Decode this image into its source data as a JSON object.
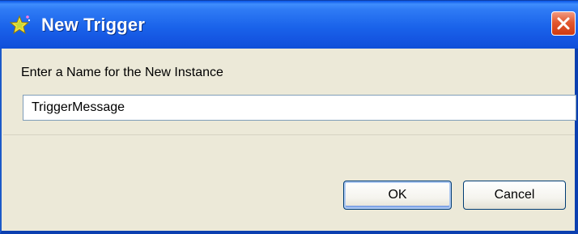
{
  "window": {
    "title": "New Trigger",
    "title_icon": "star-sparkle-icon",
    "close_icon": "close-icon"
  },
  "form": {
    "prompt": "Enter a Name for the New Instance",
    "name_value": "TriggerMessage"
  },
  "buttons": {
    "ok_label": "OK",
    "cancel_label": "Cancel"
  },
  "colors": {
    "titlebar": "#1a63ea",
    "close_button": "#e2582f",
    "dialog_background": "#ece9d8",
    "input_border": "#7f9db9"
  }
}
